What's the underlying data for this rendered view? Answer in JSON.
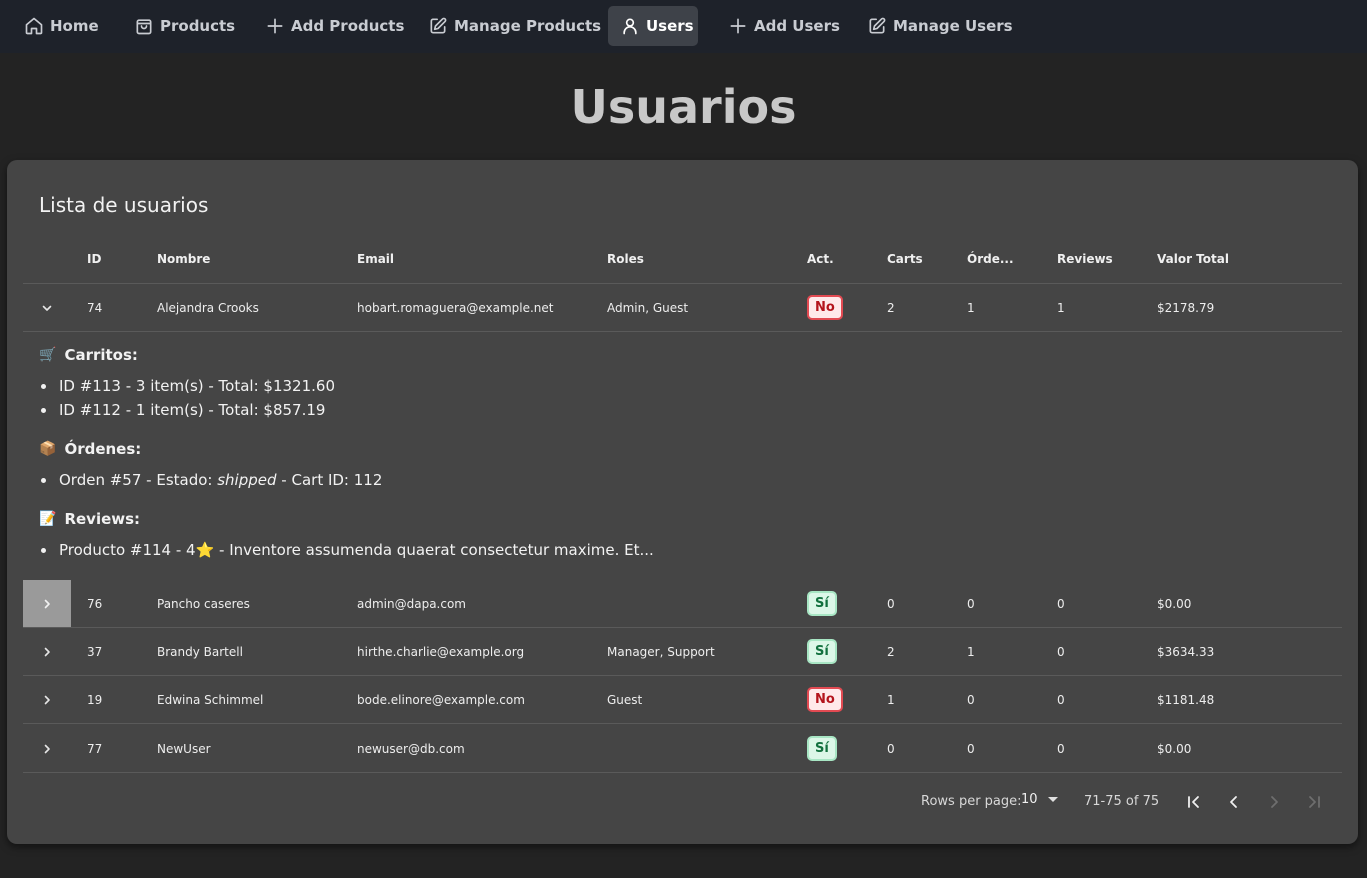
{
  "nav": {
    "items": [
      {
        "label": "Home",
        "icon": "home-icon"
      },
      {
        "label": "Products",
        "icon": "shopping-bag-icon"
      },
      {
        "label": "Add Products",
        "icon": "plus-icon"
      },
      {
        "label": "Manage Products",
        "icon": "edit-icon"
      },
      {
        "label": "Users",
        "icon": "user-icon",
        "active": true
      },
      {
        "label": "Add Users",
        "icon": "plus-icon"
      },
      {
        "label": "Manage Users",
        "icon": "edit-icon"
      }
    ]
  },
  "page_title": "Usuarios",
  "table": {
    "title": "Lista de usuarios",
    "columns": [
      "ID",
      "Nombre",
      "Email",
      "Roles",
      "Act.",
      "Carts",
      "Órde...",
      "Reviews",
      "Valor Total"
    ],
    "rows": [
      {
        "id": "74",
        "name": "Alejandra Crooks",
        "email": "hobart.romaguera@example.net",
        "roles": "Admin, Guest",
        "active": "No",
        "carts": "2",
        "orders": "1",
        "reviews": "1",
        "total": "$2178.79",
        "expanded": true
      },
      {
        "id": "76",
        "name": "Pancho caseres",
        "email": "admin@dapa.com",
        "roles": "",
        "active": "Sí",
        "carts": "0",
        "orders": "0",
        "reviews": "0",
        "total": "$0.00",
        "expanded": false
      },
      {
        "id": "37",
        "name": "Brandy Bartell",
        "email": "hirthe.charlie@example.org",
        "roles": "Manager, Support",
        "active": "Sí",
        "carts": "2",
        "orders": "1",
        "reviews": "0",
        "total": "$3634.33",
        "expanded": false
      },
      {
        "id": "19",
        "name": "Edwina Schimmel",
        "email": "bode.elinore@example.com",
        "roles": "Guest",
        "active": "No",
        "carts": "1",
        "orders": "0",
        "reviews": "0",
        "total": "$1181.48",
        "expanded": false
      },
      {
        "id": "77",
        "name": "NewUser",
        "email": "newuser@db.com",
        "roles": "",
        "active": "Sí",
        "carts": "0",
        "orders": "0",
        "reviews": "0",
        "total": "$0.00",
        "expanded": false
      }
    ]
  },
  "detail": {
    "carts_heading": "Carritos:",
    "carts_emoji": "🛒",
    "carts": [
      "ID #113 - 3 item(s) - Total: $1321.60",
      "ID #112 - 1 item(s) - Total: $857.19"
    ],
    "orders_heading": "Órdenes:",
    "orders_emoji": "📦",
    "order": {
      "prefix": "Orden #57 - Estado: ",
      "status": "shipped",
      "suffix": " - Cart ID: 112"
    },
    "reviews_heading": "Reviews:",
    "reviews_emoji": "📝",
    "reviews": [
      "Producto #114 - 4⭐ - Inventore assumenda quaerat consectetur maxime. Et..."
    ]
  },
  "pagination": {
    "rows_per_page_label": "Rows per page:",
    "rows_per_page_value": "10",
    "range": "71-75 of 75"
  },
  "colors": {
    "background": "#232323",
    "card": "#454545",
    "nav": "#1e222a",
    "badge_no": "#b4141c",
    "badge_si": "#12703e"
  }
}
